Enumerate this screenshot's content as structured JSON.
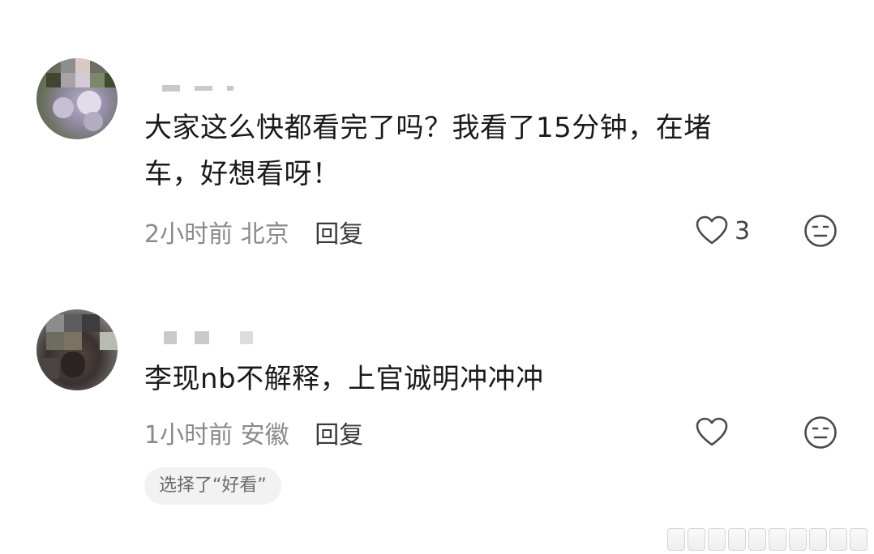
{
  "comments": [
    {
      "text_line1": "大家这么快都看完了吗？我看了15分钟，在堵",
      "text_line2": "车，好想看呀！",
      "time": "2小时前",
      "location": "北京",
      "reply_label": "回复",
      "like_count": "3",
      "like_icon": "heart-outline-icon",
      "dislike_icon": "neutral-face-icon"
    },
    {
      "text_line1": "李现nb不解释，上官诚明冲冲冲",
      "time": "1小时前",
      "location": "安徽",
      "reply_label": "回复",
      "like_count": "",
      "like_icon": "heart-outline-icon",
      "dislike_icon": "neutral-face-icon",
      "tag_label": "选择了“好看”"
    }
  ],
  "colors": {
    "text": "#1a1a1a",
    "meta": "#8a8a8a",
    "tag_bg": "#f2f2f2"
  }
}
